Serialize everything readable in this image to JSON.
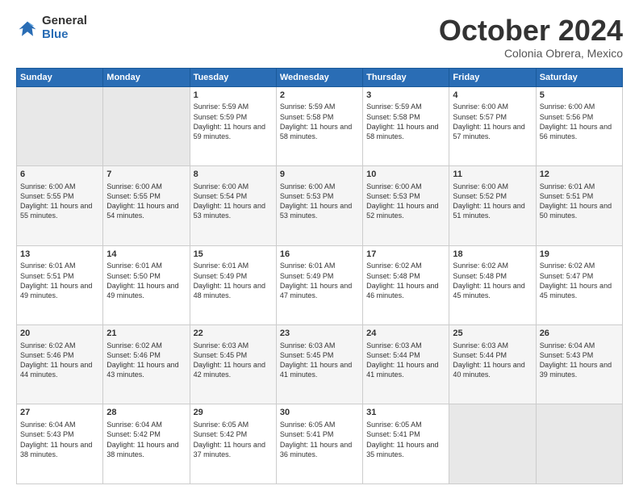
{
  "header": {
    "logo_general": "General",
    "logo_blue": "Blue",
    "month": "October 2024",
    "location": "Colonia Obrera, Mexico"
  },
  "weekdays": [
    "Sunday",
    "Monday",
    "Tuesday",
    "Wednesday",
    "Thursday",
    "Friday",
    "Saturday"
  ],
  "weeks": [
    [
      {
        "day": "",
        "info": ""
      },
      {
        "day": "",
        "info": ""
      },
      {
        "day": "1",
        "info": "Sunrise: 5:59 AM\nSunset: 5:59 PM\nDaylight: 11 hours and 59 minutes."
      },
      {
        "day": "2",
        "info": "Sunrise: 5:59 AM\nSunset: 5:58 PM\nDaylight: 11 hours and 58 minutes."
      },
      {
        "day": "3",
        "info": "Sunrise: 5:59 AM\nSunset: 5:58 PM\nDaylight: 11 hours and 58 minutes."
      },
      {
        "day": "4",
        "info": "Sunrise: 6:00 AM\nSunset: 5:57 PM\nDaylight: 11 hours and 57 minutes."
      },
      {
        "day": "5",
        "info": "Sunrise: 6:00 AM\nSunset: 5:56 PM\nDaylight: 11 hours and 56 minutes."
      }
    ],
    [
      {
        "day": "6",
        "info": "Sunrise: 6:00 AM\nSunset: 5:55 PM\nDaylight: 11 hours and 55 minutes."
      },
      {
        "day": "7",
        "info": "Sunrise: 6:00 AM\nSunset: 5:55 PM\nDaylight: 11 hours and 54 minutes."
      },
      {
        "day": "8",
        "info": "Sunrise: 6:00 AM\nSunset: 5:54 PM\nDaylight: 11 hours and 53 minutes."
      },
      {
        "day": "9",
        "info": "Sunrise: 6:00 AM\nSunset: 5:53 PM\nDaylight: 11 hours and 53 minutes."
      },
      {
        "day": "10",
        "info": "Sunrise: 6:00 AM\nSunset: 5:53 PM\nDaylight: 11 hours and 52 minutes."
      },
      {
        "day": "11",
        "info": "Sunrise: 6:00 AM\nSunset: 5:52 PM\nDaylight: 11 hours and 51 minutes."
      },
      {
        "day": "12",
        "info": "Sunrise: 6:01 AM\nSunset: 5:51 PM\nDaylight: 11 hours and 50 minutes."
      }
    ],
    [
      {
        "day": "13",
        "info": "Sunrise: 6:01 AM\nSunset: 5:51 PM\nDaylight: 11 hours and 49 minutes."
      },
      {
        "day": "14",
        "info": "Sunrise: 6:01 AM\nSunset: 5:50 PM\nDaylight: 11 hours and 49 minutes."
      },
      {
        "day": "15",
        "info": "Sunrise: 6:01 AM\nSunset: 5:49 PM\nDaylight: 11 hours and 48 minutes."
      },
      {
        "day": "16",
        "info": "Sunrise: 6:01 AM\nSunset: 5:49 PM\nDaylight: 11 hours and 47 minutes."
      },
      {
        "day": "17",
        "info": "Sunrise: 6:02 AM\nSunset: 5:48 PM\nDaylight: 11 hours and 46 minutes."
      },
      {
        "day": "18",
        "info": "Sunrise: 6:02 AM\nSunset: 5:48 PM\nDaylight: 11 hours and 45 minutes."
      },
      {
        "day": "19",
        "info": "Sunrise: 6:02 AM\nSunset: 5:47 PM\nDaylight: 11 hours and 45 minutes."
      }
    ],
    [
      {
        "day": "20",
        "info": "Sunrise: 6:02 AM\nSunset: 5:46 PM\nDaylight: 11 hours and 44 minutes."
      },
      {
        "day": "21",
        "info": "Sunrise: 6:02 AM\nSunset: 5:46 PM\nDaylight: 11 hours and 43 minutes."
      },
      {
        "day": "22",
        "info": "Sunrise: 6:03 AM\nSunset: 5:45 PM\nDaylight: 11 hours and 42 minutes."
      },
      {
        "day": "23",
        "info": "Sunrise: 6:03 AM\nSunset: 5:45 PM\nDaylight: 11 hours and 41 minutes."
      },
      {
        "day": "24",
        "info": "Sunrise: 6:03 AM\nSunset: 5:44 PM\nDaylight: 11 hours and 41 minutes."
      },
      {
        "day": "25",
        "info": "Sunrise: 6:03 AM\nSunset: 5:44 PM\nDaylight: 11 hours and 40 minutes."
      },
      {
        "day": "26",
        "info": "Sunrise: 6:04 AM\nSunset: 5:43 PM\nDaylight: 11 hours and 39 minutes."
      }
    ],
    [
      {
        "day": "27",
        "info": "Sunrise: 6:04 AM\nSunset: 5:43 PM\nDaylight: 11 hours and 38 minutes."
      },
      {
        "day": "28",
        "info": "Sunrise: 6:04 AM\nSunset: 5:42 PM\nDaylight: 11 hours and 38 minutes."
      },
      {
        "day": "29",
        "info": "Sunrise: 6:05 AM\nSunset: 5:42 PM\nDaylight: 11 hours and 37 minutes."
      },
      {
        "day": "30",
        "info": "Sunrise: 6:05 AM\nSunset: 5:41 PM\nDaylight: 11 hours and 36 minutes."
      },
      {
        "day": "31",
        "info": "Sunrise: 6:05 AM\nSunset: 5:41 PM\nDaylight: 11 hours and 35 minutes."
      },
      {
        "day": "",
        "info": ""
      },
      {
        "day": "",
        "info": ""
      }
    ]
  ]
}
